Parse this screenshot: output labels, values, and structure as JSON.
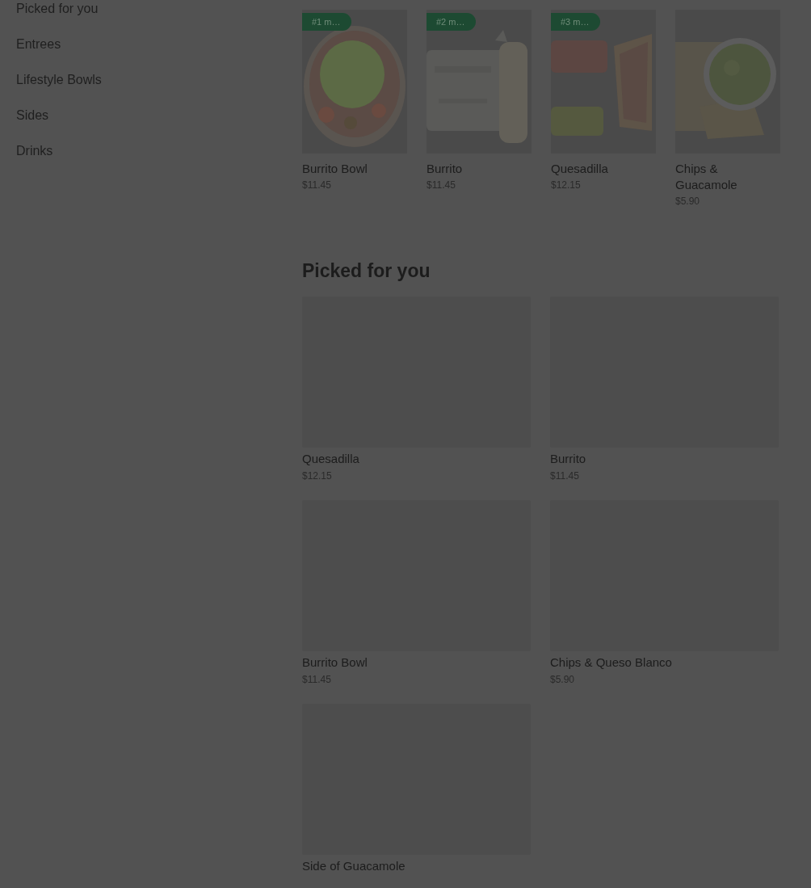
{
  "sidebar": {
    "items": [
      {
        "label": "Picked for you"
      },
      {
        "label": "Entrees"
      },
      {
        "label": "Lifestyle Bowls"
      },
      {
        "label": "Sides"
      },
      {
        "label": "Drinks"
      }
    ]
  },
  "popular_items": [
    {
      "badge": "#1 m…",
      "name": "Burrito Bowl",
      "price": "$11.45"
    },
    {
      "badge": "#2 m…",
      "name": "Burrito",
      "price": "$11.45"
    },
    {
      "badge": "#3 m…",
      "name": "Quesadilla",
      "price": "$12.15"
    },
    {
      "name": "Chips & Guacamole",
      "price": "$5.90"
    }
  ],
  "picked_for_you": {
    "title": "Picked for you",
    "items": [
      {
        "name": "Quesadilla",
        "price": "$12.15"
      },
      {
        "name": "Burrito",
        "price": "$11.45"
      },
      {
        "name": "Burrito Bowl",
        "price": "$11.45"
      },
      {
        "name": "Chips & Queso Blanco",
        "price": "$5.90"
      },
      {
        "name": "Side of Guacamole"
      }
    ]
  }
}
